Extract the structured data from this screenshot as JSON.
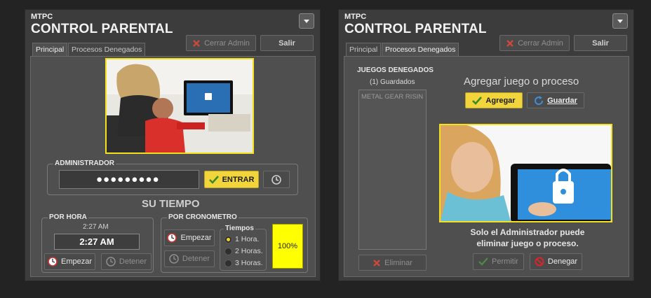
{
  "window1": {
    "app_small": "MTPC",
    "app_title": "CONTROL PARENTAL",
    "close_admin": "Cerrar Admin",
    "exit": "Salir",
    "tabs": [
      "Principal",
      "Procesos Denegados"
    ],
    "admin_label": "ADMINISTRADOR",
    "password_mask": "●●●●●●●●●",
    "enter": "ENTRAR",
    "su_tiempo": "SU TIEMPO",
    "por_hora": "POR HORA",
    "time_small": "2:27 AM",
    "time_big": "2:27 AM",
    "start": "Empezar",
    "stop": "Detener",
    "por_cronometro": "POR CRONOMETRO",
    "tiempos": "Tiempos",
    "options": [
      "1 Hora.",
      "2 Horas.",
      "3 Horas."
    ],
    "selected_option": 0,
    "percent": "100%"
  },
  "window2": {
    "app_small": "MTPC",
    "app_title": "CONTROL PARENTAL",
    "close_admin": "Cerrar Admin",
    "exit": "Salir",
    "tabs": [
      "Principal",
      "Procesos Denegados"
    ],
    "denied_title": "JUEGOS DENEGADOS",
    "saved_count": "(1) Guardados",
    "list": [
      "METAL GEAR RISIN"
    ],
    "remove": "Eliminar",
    "add_title": "Agregar juego o proceso",
    "add": "Agregar",
    "save": "Guardar",
    "caption_line1": "Solo el Administrador puede",
    "caption_line2": "eliminar juego o proceso.",
    "allow": "Permitir",
    "deny": "Denegar"
  },
  "colors": {
    "accent_yellow": "#f1d53a",
    "frame_yellow": "#f2e11c",
    "bg": "#232323",
    "window": "#3c3c3c"
  }
}
